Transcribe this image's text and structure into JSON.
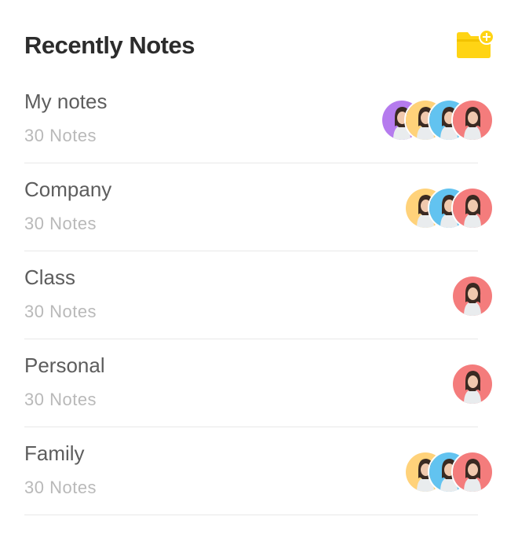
{
  "header": {
    "title": "Recently Notes",
    "add_folder_icon": "folder-plus-icon",
    "accent_color": "#FFD414"
  },
  "notes": [
    {
      "title": "My notes",
      "count": "30 Notes",
      "members": [
        "purple",
        "yellow",
        "blue",
        "red"
      ]
    },
    {
      "title": "Company",
      "count": "30 Notes",
      "members": [
        "yellow",
        "blue",
        "red"
      ]
    },
    {
      "title": "Class",
      "count": "30 Notes",
      "members": [
        "red"
      ]
    },
    {
      "title": "Personal",
      "count": "30 Notes",
      "members": [
        "red"
      ]
    },
    {
      "title": "Family",
      "count": "30 Notes",
      "members": [
        "yellow",
        "blue",
        "red"
      ]
    }
  ],
  "avatar_colors": {
    "purple": "#B57BEE",
    "yellow": "#FFD27A",
    "blue": "#62C3F0",
    "red": "#F47C7C"
  }
}
